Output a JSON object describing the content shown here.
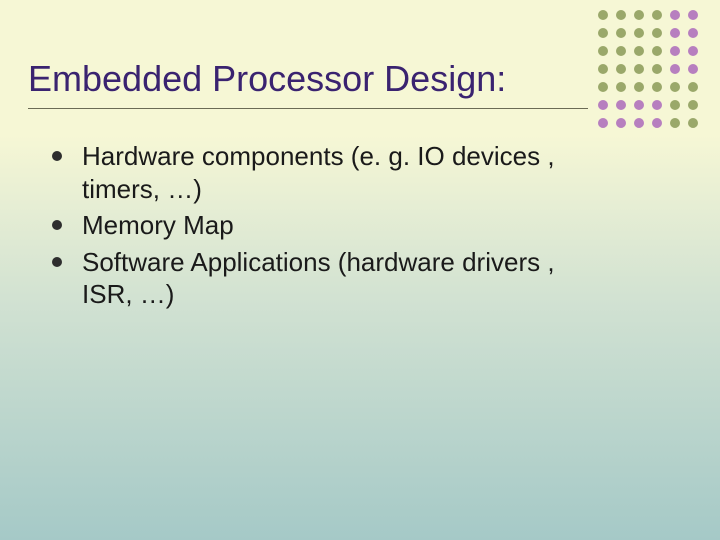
{
  "title": "Embedded Processor Design:",
  "bullets": [
    "Hardware components (e. g. IO devices , timers, …)",
    "Memory Map",
    "Software Applications (hardware drivers , ISR, …)"
  ],
  "decor": {
    "dot_rows": [
      [
        "#9aa86a",
        "#9aa86a",
        "#9aa86a",
        "#9aa86a",
        "#b77fbf",
        "#b77fbf"
      ],
      [
        "#9aa86a",
        "#9aa86a",
        "#9aa86a",
        "#9aa86a",
        "#b77fbf",
        "#b77fbf"
      ],
      [
        "#9aa86a",
        "#9aa86a",
        "#9aa86a",
        "#9aa86a",
        "#b77fbf",
        "#b77fbf"
      ],
      [
        "#9aa86a",
        "#9aa86a",
        "#9aa86a",
        "#9aa86a",
        "#b77fbf",
        "#b77fbf"
      ],
      [
        "#9aa86a",
        "#9aa86a",
        "#9aa86a",
        "#9aa86a",
        "#9aa86a",
        "#9aa86a"
      ],
      [
        "#b77fbf",
        "#b77fbf",
        "#b77fbf",
        "#b77fbf",
        "#9aa86a",
        "#9aa86a"
      ],
      [
        "#b77fbf",
        "#b77fbf",
        "#b77fbf",
        "#b77fbf",
        "#9aa86a",
        "#9aa86a"
      ]
    ]
  }
}
